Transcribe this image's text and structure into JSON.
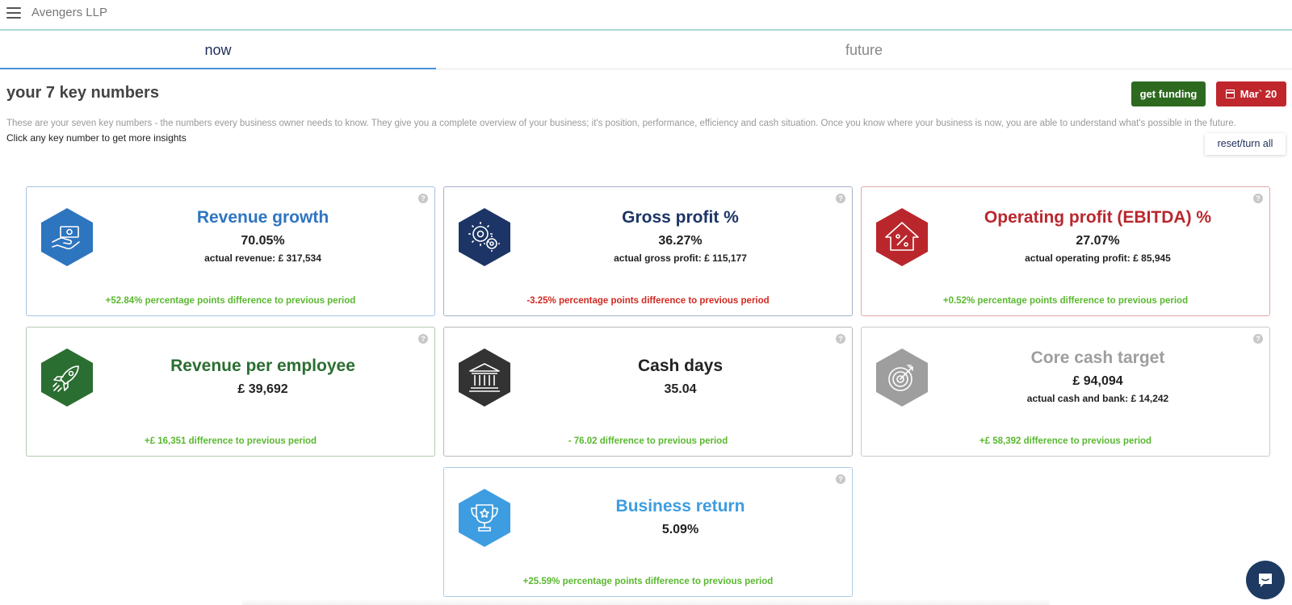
{
  "app": {
    "title": "Avengers LLP"
  },
  "tabs": [
    {
      "label": "now",
      "active": true
    },
    {
      "label": "future",
      "active": false
    }
  ],
  "page": {
    "heading": "your 7 key numbers",
    "intro": "These are your seven key numbers - the numbers every business owner needs to know. They give you a complete overview of your business; it's position, performance, efficiency and cash situation. Once you know where your business is now, you are able to understand what's possible in the future.",
    "hint": "Click any key number to get more insights",
    "reset_label": "reset/turn all"
  },
  "toolbar": {
    "funding_label": "get funding",
    "date_label": "Mar` 20",
    "funding_color": "#2d6a1f",
    "date_color": "#c0272d"
  },
  "cards": [
    {
      "title": "Revenue growth",
      "value": "70.05%",
      "sub_label": "actual revenue:",
      "sub_value": "£ 317,534",
      "diff": "+52.84% percentage points difference to previous period",
      "diff_status": "positive",
      "icon": "cash-hand-icon",
      "color": "#2e75c0"
    },
    {
      "title": "Gross profit %",
      "value": "36.27%",
      "sub_label": "actual gross profit:",
      "sub_value": "£ 115,177",
      "diff": "-3.25% percentage points difference to previous period",
      "diff_status": "negative",
      "icon": "gears-icon",
      "color": "#1c3566"
    },
    {
      "title": "Operating profit (EBITDA) %",
      "value": "27.07%",
      "sub_label": "actual operating profit:",
      "sub_value": "£ 85,945",
      "diff": "+0.52% percentage points difference to previous period",
      "diff_status": "positive",
      "icon": "house-percent-icon",
      "color": "#b9272d"
    },
    {
      "title": "Revenue per employee",
      "value": "£ 39,692",
      "diff": "+£ 16,351 difference to previous period",
      "diff_status": "positive",
      "icon": "rocket-icon",
      "color": "#2b6e31"
    },
    {
      "title": "Cash days",
      "value": "35.04",
      "diff": "- 76.02 difference to previous period",
      "diff_status": "positive",
      "icon": "bank-icon",
      "color": "#333333"
    },
    {
      "title": "Core cash target",
      "value": "£ 94,094",
      "sub_label": "actual cash and bank:",
      "sub_value": "£ 14,242",
      "diff": "+£ 58,392 difference to previous period",
      "diff_status": "positive",
      "icon": "target-icon",
      "color": "#9e9e9e"
    },
    {
      "title": "Business return",
      "value": "5.09%",
      "diff": "+25.59% percentage points difference to previous period",
      "diff_status": "positive",
      "icon": "trophy-icon",
      "color": "#3d9de0"
    }
  ],
  "help_glyph": "?",
  "chat": {
    "icon": "chat-icon",
    "color": "#1e3a63"
  }
}
